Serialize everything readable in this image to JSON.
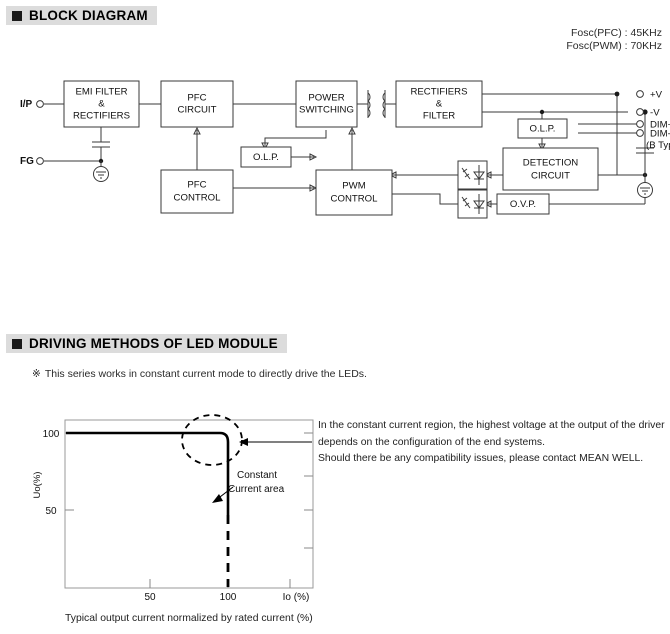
{
  "sections": {
    "block_diagram": {
      "title": "BLOCK DIAGRAM"
    },
    "driving_methods": {
      "title": "DRIVING METHODS OF LED MODULE"
    }
  },
  "block_diagram": {
    "fosc": {
      "pfc": "Fosc(PFC) : 45KHz",
      "pwm": "Fosc(PWM) : 70KHz"
    },
    "inputs": [
      {
        "name": "input-terminal",
        "label": "I/P"
      },
      {
        "name": "frame-ground-terminal",
        "label": "FG"
      }
    ],
    "blocks": [
      {
        "id": "emi-filter-rectifiers",
        "lines": [
          "EMI FILTER",
          "&",
          "RECTIFIERS"
        ]
      },
      {
        "id": "pfc-circuit",
        "lines": [
          "PFC",
          "CIRCUIT"
        ]
      },
      {
        "id": "power-switching",
        "lines": [
          "POWER",
          "SWITCHING"
        ]
      },
      {
        "id": "rectifiers-filter",
        "lines": [
          "RECTIFIERS",
          "&",
          "FILTER"
        ]
      },
      {
        "id": "pfc-control",
        "lines": [
          "PFC",
          "CONTROL"
        ]
      },
      {
        "id": "olp-primary",
        "lines": [
          "O.L.P."
        ]
      },
      {
        "id": "pwm-control",
        "lines": [
          "PWM",
          "CONTROL"
        ]
      },
      {
        "id": "olp-secondary",
        "lines": [
          "O.L.P."
        ]
      },
      {
        "id": "detection-circuit",
        "lines": [
          "DETECTION",
          "CIRCUIT"
        ]
      },
      {
        "id": "ovp",
        "lines": [
          "O.V.P."
        ]
      }
    ],
    "output_terminals": [
      {
        "id": "output-positive",
        "label": "+V"
      },
      {
        "id": "output-negative",
        "label": "-V"
      },
      {
        "id": "output-dim-positive",
        "label": "DIM+"
      },
      {
        "id": "output-dim-negative",
        "label": "DIM-"
      }
    ],
    "output_note": "(B Type)"
  },
  "driving_methods": {
    "note": "This series works in constant current mode to directly drive the LEDs.",
    "note_symbol": "※",
    "description": [
      "In the constant current region, the highest voltage at the output of the driver",
      "depends on the configuration of the end systems.",
      "Should there be any compatibility issues, please contact MEAN WELL."
    ],
    "caption": "Typical output current normalized by rated current (%)",
    "annotation": {
      "line1": "Constant",
      "line2": "Current area"
    }
  },
  "chart_data": {
    "type": "line",
    "title": "",
    "xlabel": "Io (%)",
    "ylabel": "Uo(%)",
    "xlim": [
      0,
      130
    ],
    "ylim": [
      0,
      115
    ],
    "xticks": [
      50,
      100
    ],
    "xtick_labels": [
      "50",
      "100"
    ],
    "yticks": [
      50,
      100
    ],
    "ytick_labels": [
      "50",
      "100"
    ],
    "grid": false,
    "legend_position": "none",
    "series": [
      {
        "name": "constant-voltage-region",
        "style": "solid",
        "x": [
          0,
          95,
          100,
          100
        ],
        "y": [
          100,
          100,
          97,
          55
        ]
      },
      {
        "name": "constant-current-region",
        "style": "dashed",
        "x": [
          100,
          100
        ],
        "y": [
          55,
          0
        ]
      }
    ],
    "annotations": [
      {
        "name": "knee-highlight",
        "type": "ellipse",
        "x": 92,
        "y": 100
      },
      {
        "name": "constant-current-area-label",
        "type": "text",
        "text": "Constant Current area",
        "x": 108,
        "y": 72
      }
    ]
  }
}
